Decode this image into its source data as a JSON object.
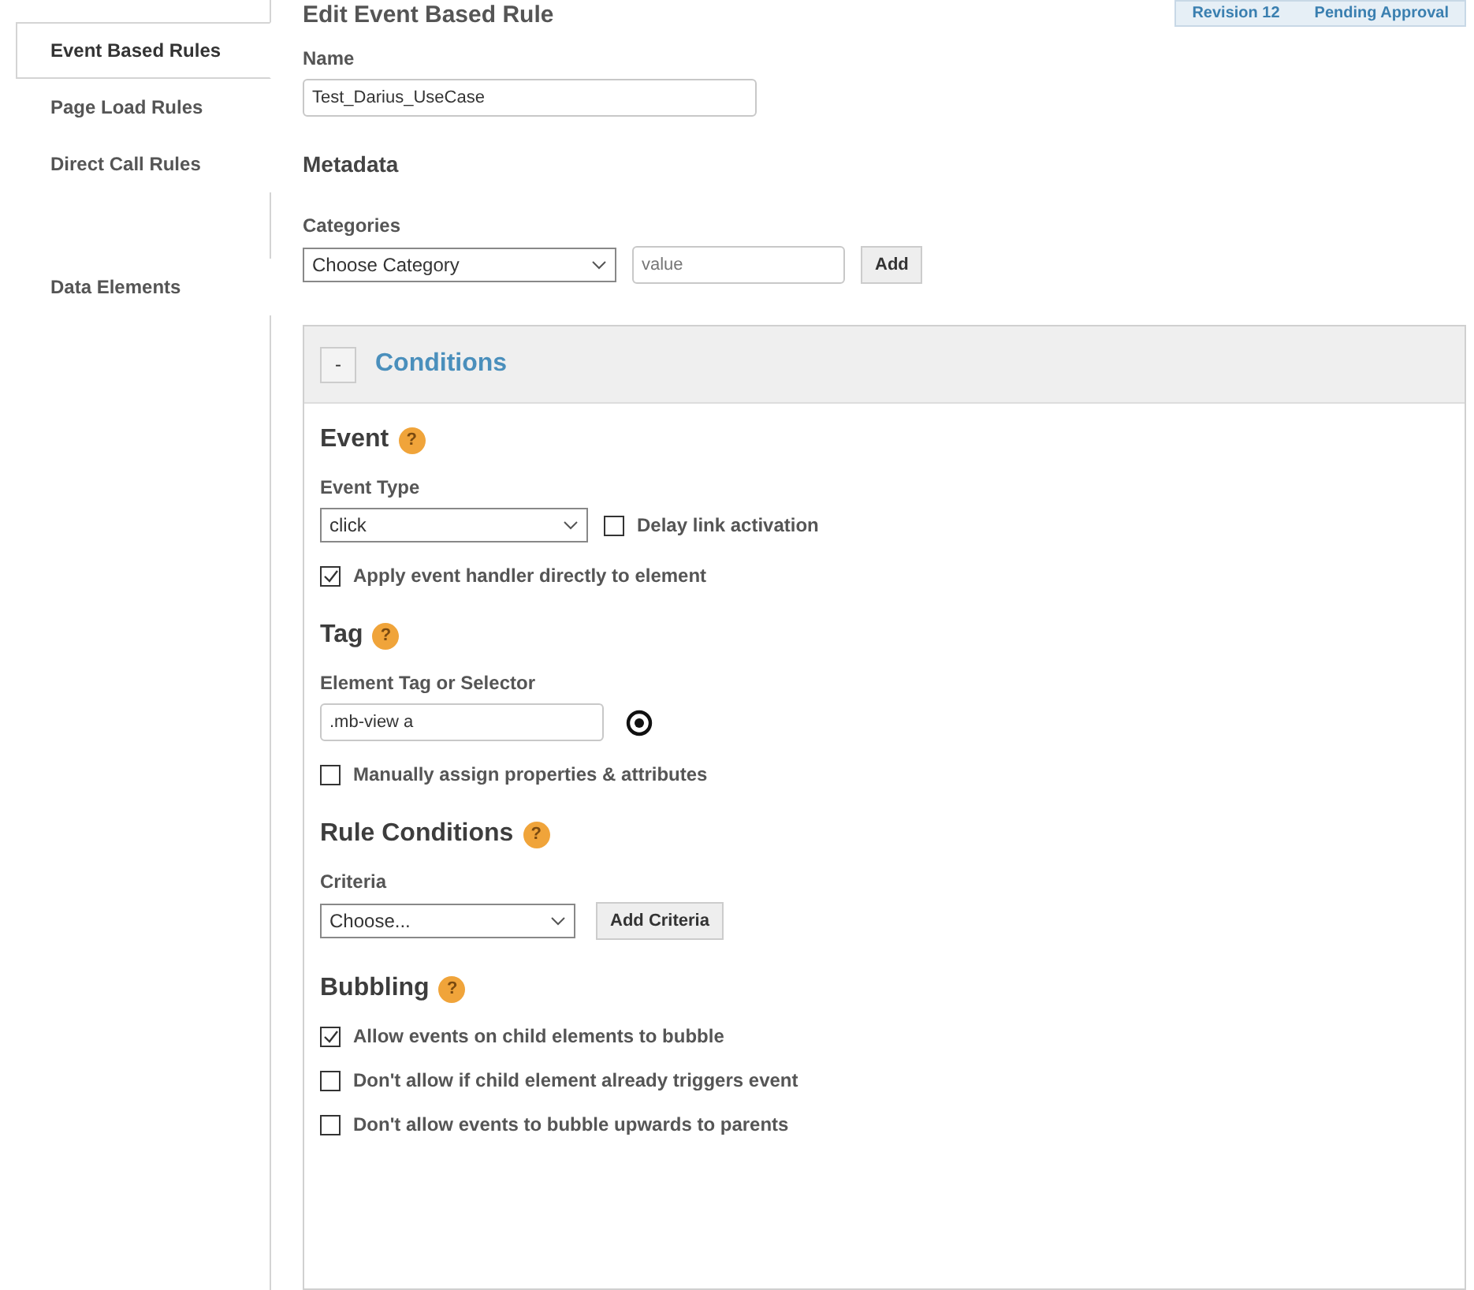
{
  "sidebar": {
    "items": [
      {
        "label": "Event Based Rules",
        "selected": true
      },
      {
        "label": "Page Load Rules",
        "selected": false
      },
      {
        "label": "Direct Call Rules",
        "selected": false
      },
      {
        "label": "Data Elements",
        "selected": false
      }
    ]
  },
  "header": {
    "title": "Edit Event Based Rule",
    "revision": "Revision 12",
    "status": "Pending Approval"
  },
  "name": {
    "label": "Name",
    "value": "Test_Darius_UseCase"
  },
  "metadata": {
    "title": "Metadata",
    "label": "Categories",
    "select": "Choose Category",
    "placeholder": "value",
    "button": "Add"
  },
  "conditions": {
    "toggle": "-",
    "title": "Conditions",
    "sections": [
      {
        "title": "Event",
        "help": "?",
        "rows": [
          {
            "kind": "select-check",
            "label": "Event Type",
            "select": "click",
            "check": {
              "label": "Delay link activation",
              "checked": false
            }
          },
          {
            "kind": "check",
            "label": "Apply event handler directly to element",
            "checked": true
          }
        ]
      },
      {
        "title": "Tag",
        "help": "?",
        "rows": [
          {
            "kind": "text-target",
            "label": "Element Tag or Selector",
            "value": ".mb-view a"
          },
          {
            "kind": "check",
            "label": "Manually assign properties & attributes",
            "checked": false
          }
        ]
      },
      {
        "title": "Rule Conditions",
        "help": "?",
        "rows": [
          {
            "kind": "select-button",
            "label": "Criteria",
            "select": "Choose...",
            "button": "Add Criteria"
          }
        ]
      },
      {
        "title": "Bubbling",
        "help": "?",
        "rows": [
          {
            "kind": "check",
            "label": "Allow events on child elements to bubble",
            "checked": true
          },
          {
            "kind": "check",
            "label": "Don't allow if child element already triggers event",
            "checked": false
          },
          {
            "kind": "check",
            "label": "Don't allow events to bubble upwards to parents",
            "checked": false
          }
        ]
      }
    ]
  }
}
